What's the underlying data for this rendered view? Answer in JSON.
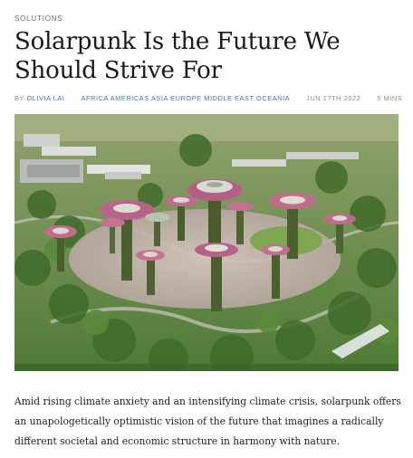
{
  "category": "SOLUTIONS",
  "title": "Solarpunk Is the Future We Should Strive For",
  "meta": {
    "by_label": "BY ",
    "author": "OLIVIA LAI",
    "regions": "AFRICA AMERICAS ASIA EUROPE MIDDLE EAST OCEANIA",
    "date": "JUN 17TH 2022",
    "read_time": "5 MINS"
  },
  "lede": "Amid rising climate anxiety and an intensifying climate crisis, solarpunk offers an unapologetically optimistic vision of the future that imagines a radically different societal and economic structure in harmony with nature.",
  "colors": {
    "link": "#3a78b5",
    "meta_gray": "#8a8a8a",
    "text": "#1e1e1e"
  }
}
